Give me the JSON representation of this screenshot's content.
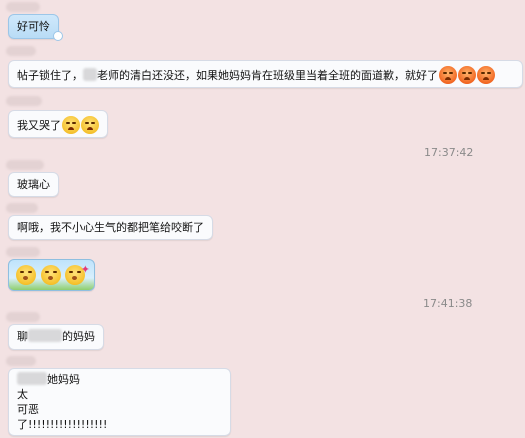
{
  "messages": [
    {
      "text": "好可怜"
    },
    {
      "text_before": "帖子锁住了，",
      "text_after": "老师的清白还没还，如果她妈妈肯在班级里当着全班的面道歉，就好了"
    },
    {
      "text": "我又哭了"
    },
    {
      "time": "17:37:42"
    },
    {
      "text": "玻璃心"
    },
    {
      "text": "啊哦，我不小心生气的都把笔给咬断了"
    },
    {
      "emoji": [
        "shy-emoji",
        "shy-emoji",
        "shy-emoji"
      ]
    },
    {
      "time": "17:41:38"
    },
    {
      "text_before": "聊",
      "text_after": "的妈妈"
    },
    {
      "lines": [
        "她妈妈",
        "太",
        "可恶",
        "了!!!!!!!!!!!!!!!!!!"
      ]
    }
  ],
  "colors": {
    "background": "#f3e2e3",
    "bubble": "#fafbfd",
    "bubble_blue": "#cfe8fb",
    "time_text": "#8a8a8a"
  }
}
